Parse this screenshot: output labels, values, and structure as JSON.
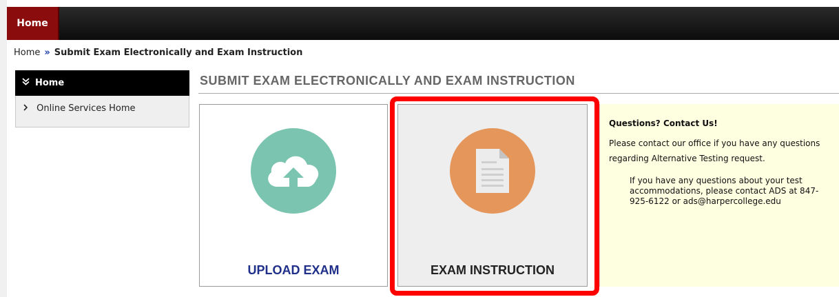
{
  "nav": {
    "home_tab": "Home"
  },
  "breadcrumb": {
    "root": "Home",
    "separator": "»",
    "current": "Submit Exam Electronically and Exam Instruction"
  },
  "sidebar": {
    "header": "Home",
    "header_icon": "double-chevron-down-icon",
    "items": [
      {
        "label": "Online Services Home",
        "icon": "chevron-right-icon"
      }
    ]
  },
  "page": {
    "title": "SUBMIT EXAM ELECTRONICALLY AND EXAM INSTRUCTION"
  },
  "cards": [
    {
      "label": "UPLOAD EXAM",
      "icon": "cloud-upload-icon",
      "color": "#7bc4b0"
    },
    {
      "label": "EXAM INSTRUCTION",
      "icon": "document-icon",
      "color": "#e4965b",
      "highlighted": true
    }
  ],
  "contact": {
    "heading": "Questions? Contact Us!",
    "text": "Please contact our office if you have any questions regarding Alternative Testing request.",
    "text2": "If you have any questions about your test accommodations, please contact ADS at 847-925-6122 or ads@harpercollege.edu"
  },
  "colors": {
    "brand_red": "#8b0c0c",
    "highlight": "#ff0000",
    "panel_bg": "#fefee0"
  }
}
